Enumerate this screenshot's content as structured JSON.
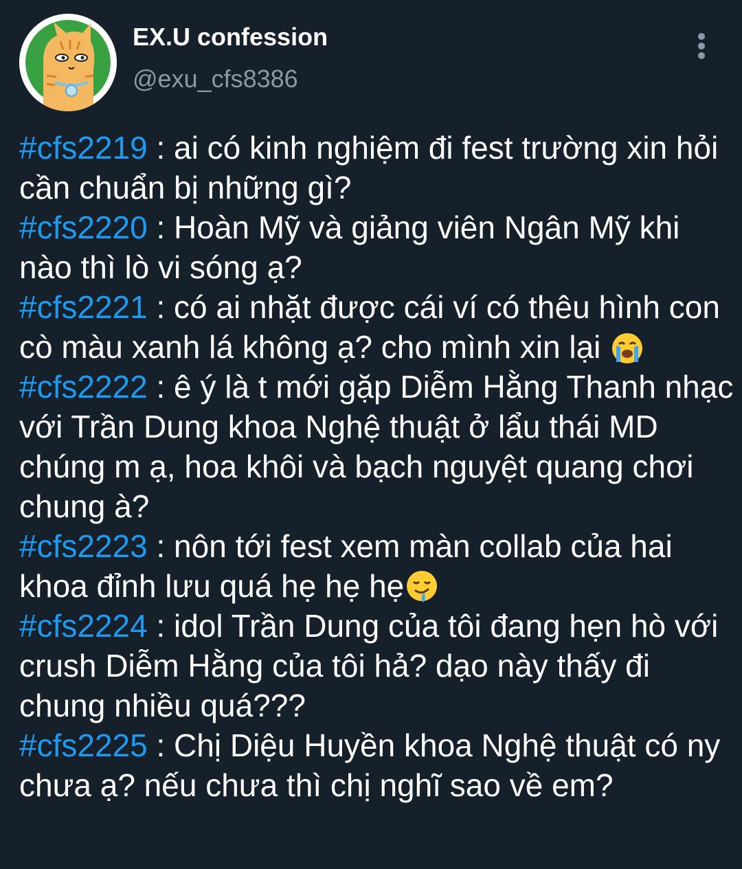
{
  "author": {
    "display_name": "EX.U confession",
    "handle": "@exu_cfs8386",
    "avatar_icon": "orange-cat-avatar"
  },
  "menu": {
    "icon": "more-vertical-icon"
  },
  "colors": {
    "background": "#15202b",
    "hashtag": "#1d9bf0",
    "secondary_text": "#8b98a5",
    "avatar_green": "#3aa142"
  },
  "confessions": [
    {
      "hashtag": "#cfs2219",
      "separator": " : ",
      "text": "ai có kinh nghiệm đi fest trường xin hỏi cần chuẩn bị những gì?"
    },
    {
      "hashtag": "#cfs2220",
      "separator": " : ",
      "text": "Hoàn Mỹ và giảng viên Ngân Mỹ khi nào thì lò vi sóng ạ?"
    },
    {
      "hashtag": "#cfs2221",
      "separator": " : ",
      "text": "có ai nhặt được cái ví có thêu hình con cò màu xanh lá không ạ? cho mình xin lại ",
      "emoji": "loudly-crying-face-emoji"
    },
    {
      "hashtag": "#cfs2222",
      "separator": " : ",
      "text": "ê ý là t mới gặp Diễm Hằng Thanh nhạc với Trần Dung khoa Nghệ thuật ở lẩu thái MD chúng m ạ, hoa khôi và bạch nguyệt quang chơi chung à?"
    },
    {
      "hashtag": "#cfs2223",
      "separator": " : ",
      "text": "nôn tới fest xem màn collab của hai khoa đỉnh lưu quá hẹ hẹ hẹ",
      "emoji": "drooling-face-emoji"
    },
    {
      "hashtag": "#cfs2224",
      "separator": " : ",
      "text": "idol Trần Dung của tôi đang hẹn hò với crush Diễm Hằng của tôi hả? dạo này thấy đi chung nhiều quá???"
    },
    {
      "hashtag": "#cfs2225",
      "separator": " : ",
      "text": "Chị Diệu Huyền khoa Nghệ thuật có ny chưa ạ? nếu chưa thì chị nghĩ sao về em?"
    }
  ]
}
